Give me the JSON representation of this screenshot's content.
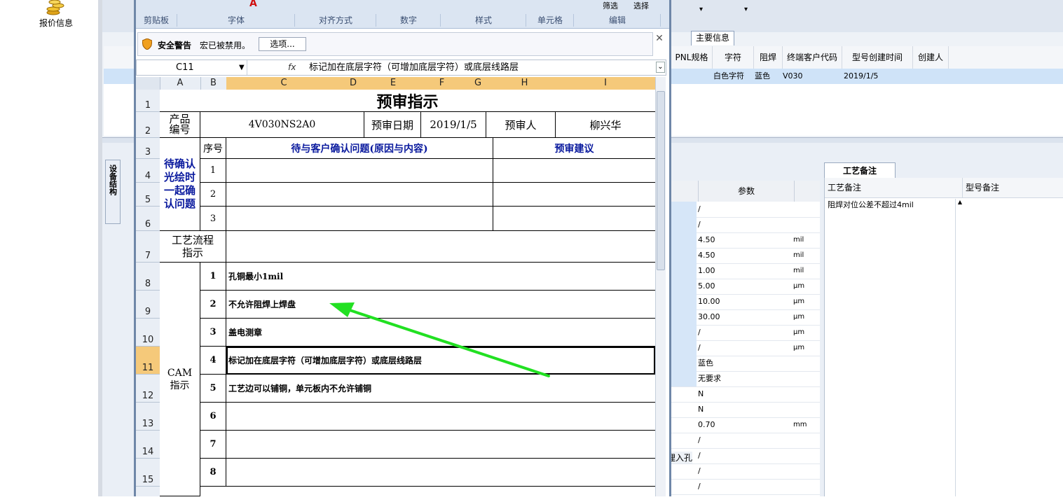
{
  "left_panel": {
    "quote_label": "报价信息"
  },
  "ribbon": {
    "groups": [
      "剪贴板",
      "字体",
      "对齐方式",
      "数字",
      "样式",
      "单元格",
      "编辑"
    ],
    "edit_buttons": [
      "筛选",
      "选择"
    ]
  },
  "security_bar": {
    "title": "安全警告",
    "message": "宏已被禁用。",
    "options_button": "选项..."
  },
  "formula_bar": {
    "name_box": "C11",
    "fx": "fx",
    "content": "标记加在底层字符（可增加底层字符）或底层线路层"
  },
  "columns": [
    "A",
    "B",
    "C",
    "D",
    "E",
    "F",
    "G",
    "H",
    "I"
  ],
  "rows": [
    "1",
    "2",
    "3",
    "4",
    "5",
    "6",
    "7",
    "8",
    "9",
    "10",
    "11",
    "12",
    "13",
    "14",
    "15"
  ],
  "active_row": "11",
  "sheet": {
    "title": "预审指示",
    "product_label": "产品编号",
    "product_value": "4V030NS2A0",
    "date_label": "预审日期",
    "date_value": "2019/1/5",
    "reviewer_label": "预审人",
    "reviewer_value": "柳兴华",
    "pending_label": "待确认光绘时一起确认问题",
    "seq_header": "序号",
    "issue_header": "待与客户确认问题(原因与内容)",
    "advice_header": "预审建议",
    "pending_seq": [
      "1",
      "2",
      "3"
    ],
    "process_label": "工艺流程指示",
    "cam_label": "CAM指示",
    "cam_items": [
      {
        "no": "1",
        "text": "孔铜最小1mil"
      },
      {
        "no": "2",
        "text": "不允许阻焊上焊盘"
      },
      {
        "no": "3",
        "text": "盖电测章"
      },
      {
        "no": "4",
        "text": "标记加在底层字符（可增加底层字符）或底层线路层"
      },
      {
        "no": "5",
        "text": "工艺边可以铺铜，单元板内不允许铺铜"
      },
      {
        "no": "6",
        "text": ""
      },
      {
        "no": "7",
        "text": ""
      },
      {
        "no": "8",
        "text": ""
      }
    ]
  },
  "background_app": {
    "tab_main": "主要信息",
    "grid_headers": [
      "PNL规格",
      "字符",
      "阻焊",
      "终端客户代码",
      "型号创建时间",
      "创建人"
    ],
    "grid_row": [
      "",
      "白色字符",
      "蓝色",
      "V030",
      "2019/1/5",
      ""
    ],
    "vertical_tab": "设备结构",
    "param_header": "参数",
    "params": [
      {
        "v": "/",
        "u": ""
      },
      {
        "v": "/",
        "u": ""
      },
      {
        "v": "4.50",
        "u": "mil"
      },
      {
        "v": "4.50",
        "u": "mil"
      },
      {
        "v": "1.00",
        "u": "mil"
      },
      {
        "v": "5.00",
        "u": "μm"
      },
      {
        "v": "10.00",
        "u": "μm"
      },
      {
        "v": "30.00",
        "u": "μm"
      },
      {
        "v": "/",
        "u": "μm"
      },
      {
        "v": "/",
        "u": "μm"
      },
      {
        "v": "蓝色",
        "u": ""
      },
      {
        "v": "无要求",
        "u": ""
      },
      {
        "v": "N",
        "u": ""
      },
      {
        "v": "N",
        "u": ""
      },
      {
        "v": "0.70",
        "u": "mm"
      },
      {
        "v": "/",
        "u": ""
      },
      {
        "v": "/",
        "u": ""
      },
      {
        "v": "/",
        "u": ""
      },
      {
        "v": "/",
        "u": ""
      }
    ],
    "param_side_label": "埋入孔",
    "notes_tab": "工艺备注",
    "notes_col1": "工艺备注",
    "notes_col2": "型号备注",
    "notes_text": "阻焊对位公差不超过4mil"
  },
  "colors": {
    "arrow": "#22e022",
    "active_header": "#f5c97a",
    "blue_text": "#0a1a9e"
  }
}
